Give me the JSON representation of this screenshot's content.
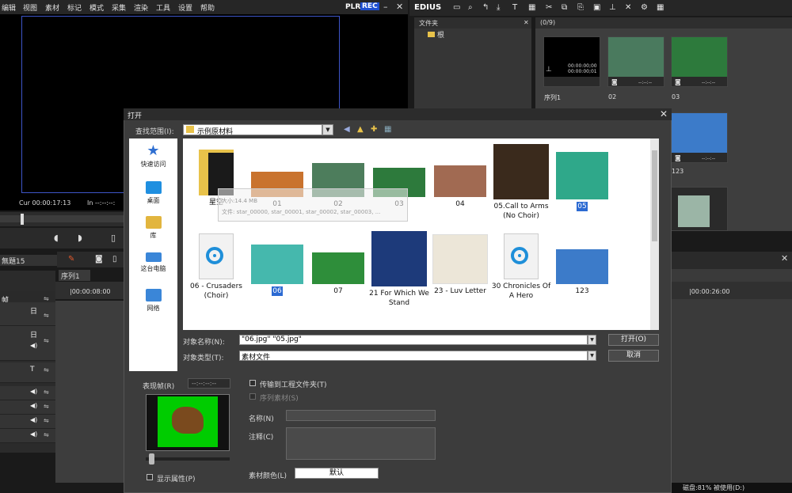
{
  "menubar": {
    "items": [
      "编辑",
      "视图",
      "素材",
      "标记",
      "模式",
      "采集",
      "渲染",
      "工具",
      "设置",
      "帮助"
    ],
    "plr": "PLR",
    "rec": "REC",
    "win_buttons": [
      "–",
      "✕"
    ]
  },
  "player": {
    "cur_timecode": "Cur 00:00:17:13",
    "in_timecode": "In --:--:--:"
  },
  "timeline": {
    "sequence_title": "序列1",
    "tab_name": "無題15",
    "ruler_left": "|00:00:08:00",
    "ruler_right": "|00:00:26:00",
    "track_channel_label": "帧",
    "track_labels": [
      "日",
      "日",
      "T",
      "◀)",
      "◀)",
      "◀)",
      "◀)"
    ],
    "status": "磁盘:81% 被使用(D:)"
  },
  "bin": {
    "app_name": "EDIUS",
    "folder_header": "文件夹",
    "folder_root": "根",
    "clip_header": "(0/9)",
    "clips": [
      {
        "name": "序列1",
        "tc1": "00:00:00;00",
        "tc2": "00:00:00;01"
      },
      {
        "name": "02",
        "tc1": "--:--:--",
        "tc2": ""
      },
      {
        "name": "03",
        "tc1": "--:--:--",
        "tc2": ""
      },
      {
        "name": "123",
        "tc1": "--:--:--",
        "tc2": ""
      }
    ]
  },
  "dialog": {
    "title": "打开",
    "close": "✕",
    "look_in_label": "查找范围(I):",
    "look_in_value": "示例原材料",
    "places": [
      {
        "label": "快速访问",
        "color": "#2f6fd1"
      },
      {
        "label": "桌面",
        "color": "#1f8fe0"
      },
      {
        "label": "库",
        "color": "#e2b53e"
      },
      {
        "label": "这台电脑",
        "color": "#3a86d8"
      },
      {
        "label": "网络",
        "color": "#3a86d8"
      }
    ],
    "files_row1": [
      {
        "name": "星空",
        "kind": "folder",
        "selected": false
      },
      {
        "name": "01",
        "kind": "image",
        "color": "#c9732e",
        "selected": false
      },
      {
        "name": "02",
        "kind": "image",
        "color": "#4d7d5c",
        "selected": false
      },
      {
        "name": "03",
        "kind": "image",
        "color": "#2d7a3c",
        "selected": false
      },
      {
        "name": "04",
        "kind": "image",
        "color": "#a16a52",
        "selected": false
      },
      {
        "name": "05.Call to Arms (No Choir)",
        "kind": "image",
        "color": "#3a2a1c",
        "selected": false
      },
      {
        "name": "05",
        "kind": "image",
        "color": "#2fa88a",
        "selected": true
      }
    ],
    "files_row2": [
      {
        "name": "06 - Crusaders (Choir)",
        "kind": "audio",
        "selected": false
      },
      {
        "name": "06",
        "kind": "image",
        "color": "#45b8ad",
        "selected": true
      },
      {
        "name": "07",
        "kind": "image",
        "color": "#2e8e3a",
        "selected": false
      },
      {
        "name": "21 For Which We Stand",
        "kind": "image",
        "color": "#1d3a7a",
        "selected": false
      },
      {
        "name": "23 - Luv Letter",
        "kind": "image",
        "color": "#ece6d8",
        "selected": false
      },
      {
        "name": "30 Chronicles Of A Hero",
        "kind": "audio",
        "selected": false
      },
      {
        "name": "123",
        "kind": "image",
        "color": "#3c7bc9",
        "selected": false
      }
    ],
    "tooltip_size": "大小:14.4 MB",
    "tooltip_files": "文件: star_00000, star_00001, star_00002, star_00003, ...",
    "name_label": "对象名称(N):",
    "name_value": "\"06.jpg\" \"05.jpg\"",
    "type_label": "对象类型(T):",
    "type_value": "素材文件",
    "open_button": "打开(O)",
    "cancel_button": "取消",
    "preview_label": "表现帧(R)",
    "preview_tc": "--:--:--:--",
    "show_props_label": "显示属性(P)",
    "transfer_label": "传输到工程文件夹(T)",
    "sequence_label": "序列素材(S)",
    "filename_label": "名称(N)",
    "note_label": "注释(C)",
    "color_label": "素材颜色(L)",
    "color_value": "默认"
  }
}
